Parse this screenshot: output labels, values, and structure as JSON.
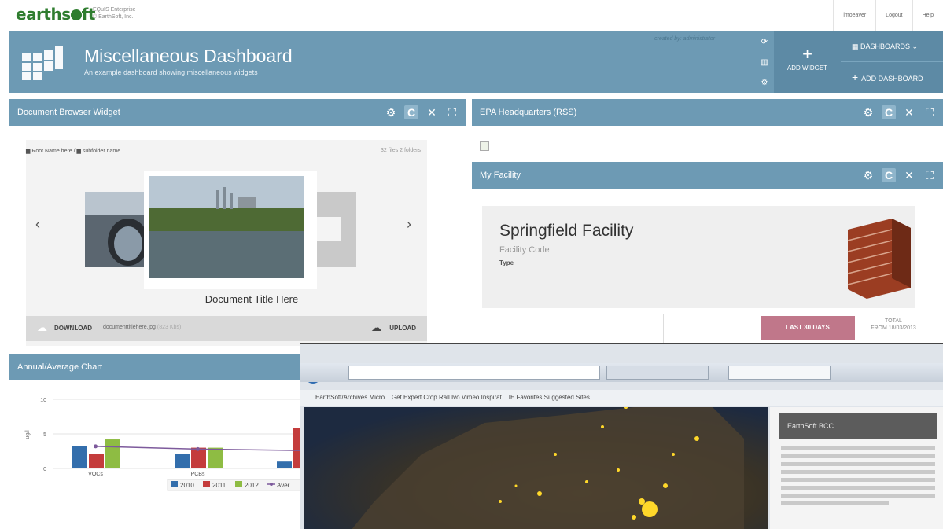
{
  "topbar": {
    "logo_text": "earthsoft",
    "logo_sub_line1": "EQuIS Enterprise",
    "logo_sub_line2": "© EarthSoft, Inc.",
    "links": [
      "imoeaver",
      "Logout",
      "Help"
    ]
  },
  "header": {
    "title": "Miscellaneous Dashboard",
    "subtitle": "An example dashboard showing miscellaneous widgets",
    "created_by": "created by: administrator",
    "add_widget": "ADD WIDGET",
    "dashboards": "DASHBOARDS",
    "add_dashboard": "ADD DASHBOARD"
  },
  "doc_widget": {
    "title": "Document Browser Widget",
    "breadcrumb_root": "Root Name here",
    "breadcrumb_sub": "subfolder name",
    "file_count": "32 files  2 folders",
    "doc_title": "Document Title Here",
    "download": "DOWNLOAD",
    "filename": "documenttitlehere.jpg",
    "filesize": "(823 Kbs)",
    "upload": "UPLOAD"
  },
  "rss_widget": {
    "title": "EPA Headquarters (RSS)"
  },
  "facility_widget": {
    "title": "My Facility",
    "name": "Springfield Facility",
    "code": "Facility Code",
    "type": "Type",
    "last_30": "LAST 30 DAYS",
    "total_line1": "TOTAL",
    "total_line2": "FROM 18/03/2013"
  },
  "chart_widget": {
    "title": "Annual/Average Chart"
  },
  "chart_data": {
    "type": "bar",
    "categories": [
      "VOCs",
      "PCBs",
      ""
    ],
    "series": [
      {
        "name": "2010",
        "values": [
          3.2,
          2.1,
          1.0
        ],
        "color": "#336eac"
      },
      {
        "name": "2011",
        "values": [
          2.1,
          3.0,
          5.8
        ],
        "color": "#c43c3c"
      },
      {
        "name": "2012",
        "values": [
          4.2,
          3.0,
          null
        ],
        "color": "#8ebc43"
      },
      {
        "name": "Aver",
        "values": [
          3.2,
          2.8,
          null
        ],
        "color": "#7d5a9c"
      }
    ],
    "ylabel": "ug/l",
    "yticks": [
      "10",
      "5",
      "0"
    ],
    "ylim": [
      0,
      10
    ],
    "legend": [
      "2010",
      "2011",
      "2012",
      "Aver"
    ],
    "legend_position": "bottom"
  },
  "photo": {
    "bookmarks": "EarthSoft/Archives Micro...   Get Expert   Crop   Rall Ivo   Vimeo   Inspirat...   IE   Favorites   Suggested Sites",
    "sidebar_title": "EarthSoft BCC"
  }
}
